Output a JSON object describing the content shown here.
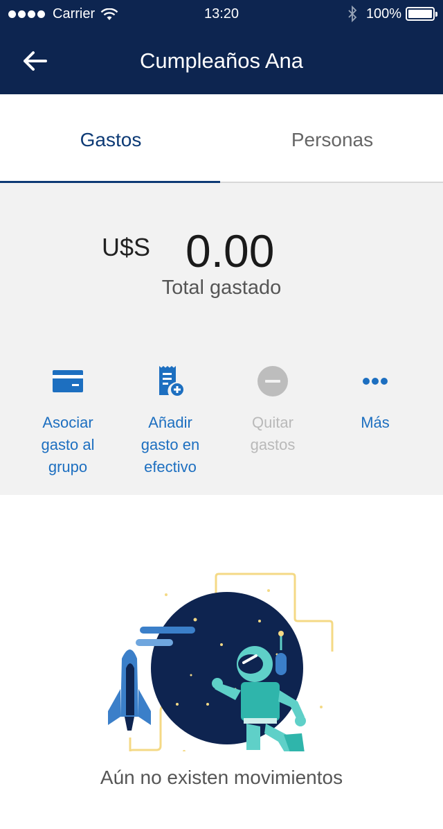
{
  "status_bar": {
    "carrier": "Carrier",
    "time": "13:20",
    "battery": "100%"
  },
  "nav": {
    "title": "Cumpleaños Ana"
  },
  "tabs": [
    {
      "label": "Gastos",
      "active": true
    },
    {
      "label": "Personas",
      "active": false
    }
  ],
  "summary": {
    "currency": "U$S",
    "amount": "0.00",
    "label": "Total gastado"
  },
  "actions": [
    {
      "line1": "Asociar",
      "line2": "gasto al",
      "line3": "grupo",
      "icon": "card-icon",
      "enabled": true
    },
    {
      "line1": "Añadir",
      "line2": "gasto en",
      "line3": "efectivo",
      "icon": "receipt-add-icon",
      "enabled": true
    },
    {
      "line1": "Quitar",
      "line2": "gastos",
      "icon": "minus-circle-icon",
      "enabled": false
    },
    {
      "line1": "Más",
      "icon": "more-icon",
      "enabled": true
    }
  ],
  "empty_state": {
    "message": "Aún no existen movimientos"
  },
  "colors": {
    "navy": "#0d2550",
    "accent_blue": "#1d6fc0",
    "tab_active": "#0d3a75"
  }
}
